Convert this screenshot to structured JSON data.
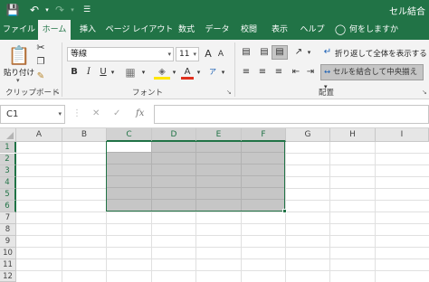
{
  "title_bar": {
    "title": "セル結合"
  },
  "tabs": [
    {
      "label": "ファイル"
    },
    {
      "label": "ホーム"
    },
    {
      "label": "挿入"
    },
    {
      "label": "ページ レイアウト"
    },
    {
      "label": "数式"
    },
    {
      "label": "データ"
    },
    {
      "label": "校閲"
    },
    {
      "label": "表示"
    },
    {
      "label": "ヘルプ"
    }
  ],
  "tell_me": "何をしますか",
  "clipboard": {
    "paste_label": "貼り付け",
    "group_label": "クリップボード"
  },
  "font": {
    "name": "等線",
    "size": "11",
    "grow": "A",
    "shrink": "A",
    "bold": "B",
    "italic": "I",
    "underline": "U",
    "color_glyph": "A",
    "group_label": "フォント"
  },
  "alignment": {
    "wrap_label": "折り返して全体を表示する",
    "merge_label": "セルを結合して中央揃え",
    "group_label": "配置"
  },
  "formula_bar": {
    "name_box": "C1",
    "cancel": "✕",
    "enter": "✓",
    "fx": "fx",
    "value": ""
  },
  "sheet": {
    "columns": [
      "A",
      "B",
      "C",
      "D",
      "E",
      "F",
      "G",
      "H",
      "I"
    ],
    "rows": [
      "1",
      "2",
      "3",
      "4",
      "5",
      "6",
      "7",
      "8",
      "9",
      "10",
      "11",
      "12"
    ],
    "selection": "C1:F6"
  },
  "colors": {
    "accent": "#217346",
    "selection_fill": "#c6c6c6"
  }
}
